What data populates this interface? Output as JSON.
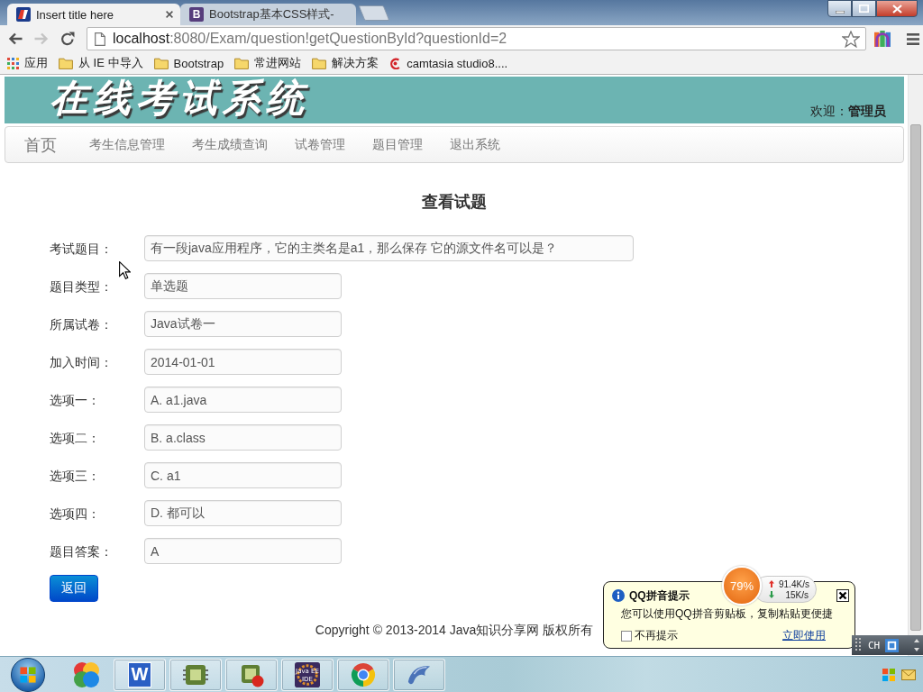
{
  "browser": {
    "tabs": [
      {
        "title": "Insert title here",
        "selected": true
      },
      {
        "title": "Bootstrap基本CSS样式-",
        "selected": false,
        "favicon_letter": "B"
      }
    ],
    "nav_buttons": [
      {
        "kind": "back",
        "disabled": false
      },
      {
        "kind": "forward",
        "disabled": true
      },
      {
        "kind": "reload",
        "disabled": false
      }
    ],
    "address": {
      "host": "localhost",
      "path": ":8080/Exam/question!getQuestionById?questionId=2"
    },
    "bookmarks": [
      {
        "kind": "apps",
        "label": "应用"
      },
      {
        "kind": "folder",
        "label": "从 IE 中导入"
      },
      {
        "kind": "folder",
        "label": "Bootstrap"
      },
      {
        "kind": "folder",
        "label": "常进网站"
      },
      {
        "kind": "folder",
        "label": "解决方案"
      },
      {
        "kind": "site",
        "label": "camtasia studio8...."
      }
    ]
  },
  "header": {
    "logo": "在线考试系统",
    "welcome": "欢迎：**管理员**"
  },
  "nav": [
    {
      "kind": "brand",
      "label": "首页"
    },
    {
      "kind": "link",
      "label": "考生信息管理"
    },
    {
      "kind": "link",
      "label": "考生成绩查询"
    },
    {
      "kind": "link",
      "label": "试卷管理"
    },
    {
      "kind": "link",
      "label": "题目管理"
    },
    {
      "kind": "link",
      "label": "退出系统"
    }
  ],
  "page_title": "查看试题",
  "form": [
    {
      "label": "考试题目：",
      "value": "有一段java应用程序，它的主类名是a1，那么保存 它的源文件名可以是？",
      "kind": "wide"
    },
    {
      "label": "题目类型：",
      "value": "单选题",
      "kind": "short"
    },
    {
      "label": "所属试卷：",
      "value": "Java试卷一",
      "kind": "short"
    },
    {
      "label": "加入时间：",
      "value": "2014-01-01",
      "kind": "short"
    },
    {
      "label": "选项一：",
      "value": "A. a1.java",
      "kind": "short"
    },
    {
      "label": "选项二：",
      "value": "B. a.class",
      "kind": "short"
    },
    {
      "label": "选项三：",
      "value": "C. a1",
      "kind": "short"
    },
    {
      "label": "选项四：",
      "value": "D. 都可以",
      "kind": "short"
    },
    {
      "label": "题目答案：",
      "value": "A",
      "kind": "short"
    }
  ],
  "back_button": "返回",
  "footer": "Copyright © 2013-2014 Java知识分享网 版权所有",
  "qq_popup": {
    "title": "QQ拼音提示",
    "message": "您可以使用QQ拼音剪贴板，复制粘贴更便捷",
    "checkbox": {
      "label": "不再提示",
      "checked": false
    },
    "link": "立即使用"
  },
  "net_meter": {
    "usage": "79%",
    "upload": "91.4K/s",
    "download": "15K/s"
  },
  "language_bar": {
    "label": "CH"
  },
  "taskbar": {
    "apps": [
      {
        "kind": "circles"
      },
      {
        "kind": "letter",
        "letter": "W"
      },
      {
        "kind": "chip"
      },
      {
        "kind": "chip-record"
      },
      {
        "kind": "badge",
        "lines": [
          "Java EE",
          "IDE"
        ]
      },
      {
        "kind": "round-logo"
      },
      {
        "kind": "dolphin"
      }
    ]
  }
}
